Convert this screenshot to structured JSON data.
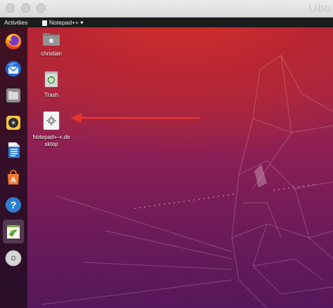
{
  "window": {
    "title": "Ubu"
  },
  "topbar": {
    "activities_label": "Activities",
    "app_menu_label": "Notepad++ ▾"
  },
  "dock": {
    "items": [
      {
        "name": "firefox",
        "icon": "firefox-icon"
      },
      {
        "name": "thunderbird",
        "icon": "thunderbird-icon"
      },
      {
        "name": "files",
        "icon": "files-icon"
      },
      {
        "name": "rhythmbox",
        "icon": "rhythmbox-icon"
      },
      {
        "name": "libreoffice-writer",
        "icon": "writer-icon"
      },
      {
        "name": "software",
        "icon": "software-icon"
      },
      {
        "name": "help",
        "icon": "help-icon"
      },
      {
        "name": "notepad-plus-plus",
        "icon": "notepad-icon",
        "active": true
      },
      {
        "name": "disc",
        "icon": "disc-icon"
      }
    ]
  },
  "desktop": {
    "icons": [
      {
        "label": "christian",
        "icon": "home-folder-icon"
      },
      {
        "label": "Trash",
        "icon": "trash-icon"
      },
      {
        "label": "Notepad+-+.desktop",
        "icon": "desktop-file-icon"
      }
    ]
  },
  "colors": {
    "arrow": "#e8342c",
    "topbar": "#1b1b1b"
  }
}
